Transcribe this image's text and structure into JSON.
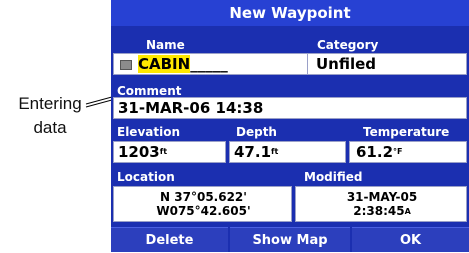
{
  "annotation": {
    "line1": "Entering",
    "line2": "data"
  },
  "window": {
    "title": "New Waypoint"
  },
  "name": {
    "label": "Name",
    "value_highlighted": "CABIN",
    "value_rest": "_____"
  },
  "category": {
    "label": "Category",
    "value": "Unfiled"
  },
  "comment": {
    "label": "Comment",
    "value": "31-MAR-06 14:38"
  },
  "elevation": {
    "label": "Elevation",
    "value": "1203",
    "unit": "ft"
  },
  "depth": {
    "label": "Depth",
    "value": "47.1",
    "unit": "ft"
  },
  "temperature": {
    "label": "Temperature",
    "value": "61.2",
    "unit": "°F"
  },
  "location": {
    "label": "Location",
    "line1": "N  37°05.622'",
    "line2": "W075°42.605'"
  },
  "modified": {
    "label": "Modified",
    "date": "31-MAY-05",
    "time": "2:38:45",
    "time_suffix": "A"
  },
  "buttons": {
    "delete": "Delete",
    "show_map": "Show Map",
    "ok": "OK"
  },
  "colors": {
    "panel_bg": "#1b2fb0",
    "title_bg": "#2741d3",
    "highlight": "#ffe800",
    "field_bg": "#ffffff"
  },
  "icons": {
    "waypoint_symbol": "waypoint-symbol-icon"
  }
}
